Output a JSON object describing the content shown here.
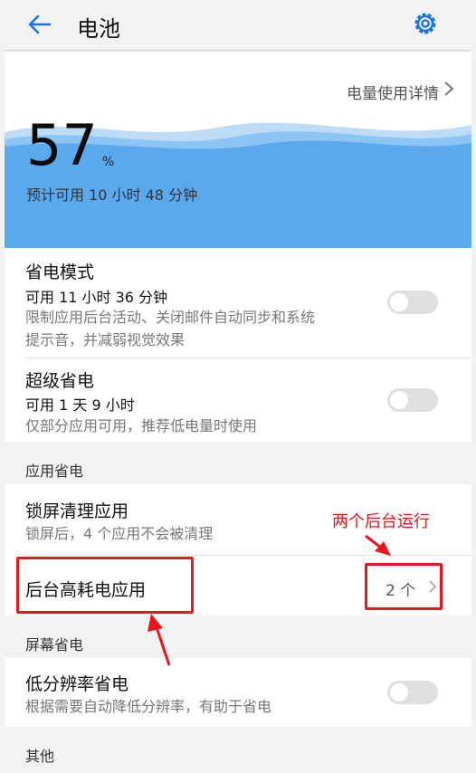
{
  "header": {
    "title": "电池"
  },
  "battery": {
    "usage_link": "电量使用详情",
    "percent": "57",
    "percent_sign": "%",
    "remaining": "预计可用 10 小时 48 分钟"
  },
  "power_saving": {
    "title": "省电模式",
    "sub": "可用 11 小时 36 分钟",
    "desc_line1": "限制应用后台活动、关闭邮件自动同步和系统",
    "desc_line2": "提示音，并减弱视觉效果",
    "enabled": false
  },
  "ultra_saving": {
    "title": "超级省电",
    "sub": "可用 1 天 9 小时",
    "desc": "仅部分应用可用，推荐低电量时使用",
    "enabled": false
  },
  "app_saving": {
    "label": "应用省电",
    "lock_clean": {
      "title": "锁屏清理应用",
      "desc": "锁屏后，4 个应用不会被清理"
    },
    "high_usage": {
      "title": "后台高耗电应用",
      "count": "2 个"
    }
  },
  "screen_saving": {
    "label": "屏幕省电",
    "low_res": {
      "title": "低分辨率省电",
      "desc": "根据需要自动降低分辨率，有助于省电",
      "enabled": false
    }
  },
  "other": {
    "label": "其他"
  },
  "annotation": {
    "text": "两个后台运行"
  },
  "colors": {
    "accent": "#1a73e8",
    "wave": "#5aa9ef",
    "annotation": "#e8161e"
  }
}
